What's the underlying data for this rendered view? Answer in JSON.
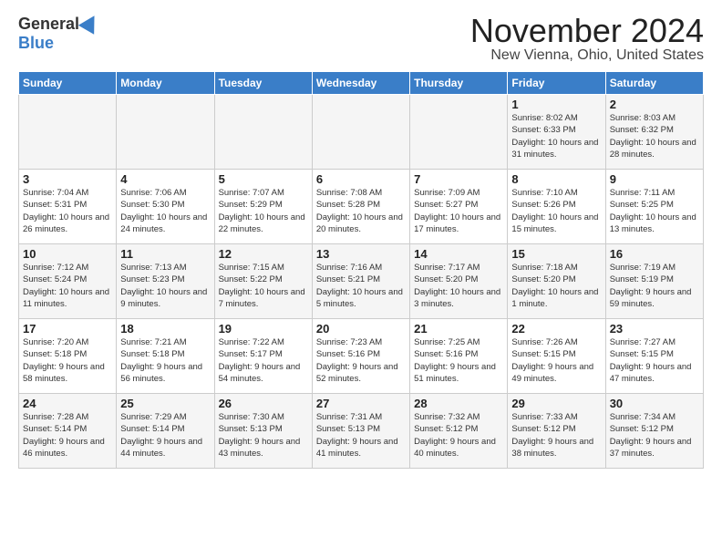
{
  "logo": {
    "general": "General",
    "blue": "Blue"
  },
  "title": "November 2024",
  "location": "New Vienna, Ohio, United States",
  "days_of_week": [
    "Sunday",
    "Monday",
    "Tuesday",
    "Wednesday",
    "Thursday",
    "Friday",
    "Saturday"
  ],
  "weeks": [
    [
      {
        "day": "",
        "info": ""
      },
      {
        "day": "",
        "info": ""
      },
      {
        "day": "",
        "info": ""
      },
      {
        "day": "",
        "info": ""
      },
      {
        "day": "",
        "info": ""
      },
      {
        "day": "1",
        "info": "Sunrise: 8:02 AM\nSunset: 6:33 PM\nDaylight: 10 hours and 31 minutes."
      },
      {
        "day": "2",
        "info": "Sunrise: 8:03 AM\nSunset: 6:32 PM\nDaylight: 10 hours and 28 minutes."
      }
    ],
    [
      {
        "day": "3",
        "info": "Sunrise: 7:04 AM\nSunset: 5:31 PM\nDaylight: 10 hours and 26 minutes."
      },
      {
        "day": "4",
        "info": "Sunrise: 7:06 AM\nSunset: 5:30 PM\nDaylight: 10 hours and 24 minutes."
      },
      {
        "day": "5",
        "info": "Sunrise: 7:07 AM\nSunset: 5:29 PM\nDaylight: 10 hours and 22 minutes."
      },
      {
        "day": "6",
        "info": "Sunrise: 7:08 AM\nSunset: 5:28 PM\nDaylight: 10 hours and 20 minutes."
      },
      {
        "day": "7",
        "info": "Sunrise: 7:09 AM\nSunset: 5:27 PM\nDaylight: 10 hours and 17 minutes."
      },
      {
        "day": "8",
        "info": "Sunrise: 7:10 AM\nSunset: 5:26 PM\nDaylight: 10 hours and 15 minutes."
      },
      {
        "day": "9",
        "info": "Sunrise: 7:11 AM\nSunset: 5:25 PM\nDaylight: 10 hours and 13 minutes."
      }
    ],
    [
      {
        "day": "10",
        "info": "Sunrise: 7:12 AM\nSunset: 5:24 PM\nDaylight: 10 hours and 11 minutes."
      },
      {
        "day": "11",
        "info": "Sunrise: 7:13 AM\nSunset: 5:23 PM\nDaylight: 10 hours and 9 minutes."
      },
      {
        "day": "12",
        "info": "Sunrise: 7:15 AM\nSunset: 5:22 PM\nDaylight: 10 hours and 7 minutes."
      },
      {
        "day": "13",
        "info": "Sunrise: 7:16 AM\nSunset: 5:21 PM\nDaylight: 10 hours and 5 minutes."
      },
      {
        "day": "14",
        "info": "Sunrise: 7:17 AM\nSunset: 5:20 PM\nDaylight: 10 hours and 3 minutes."
      },
      {
        "day": "15",
        "info": "Sunrise: 7:18 AM\nSunset: 5:20 PM\nDaylight: 10 hours and 1 minute."
      },
      {
        "day": "16",
        "info": "Sunrise: 7:19 AM\nSunset: 5:19 PM\nDaylight: 9 hours and 59 minutes."
      }
    ],
    [
      {
        "day": "17",
        "info": "Sunrise: 7:20 AM\nSunset: 5:18 PM\nDaylight: 9 hours and 58 minutes."
      },
      {
        "day": "18",
        "info": "Sunrise: 7:21 AM\nSunset: 5:18 PM\nDaylight: 9 hours and 56 minutes."
      },
      {
        "day": "19",
        "info": "Sunrise: 7:22 AM\nSunset: 5:17 PM\nDaylight: 9 hours and 54 minutes."
      },
      {
        "day": "20",
        "info": "Sunrise: 7:23 AM\nSunset: 5:16 PM\nDaylight: 9 hours and 52 minutes."
      },
      {
        "day": "21",
        "info": "Sunrise: 7:25 AM\nSunset: 5:16 PM\nDaylight: 9 hours and 51 minutes."
      },
      {
        "day": "22",
        "info": "Sunrise: 7:26 AM\nSunset: 5:15 PM\nDaylight: 9 hours and 49 minutes."
      },
      {
        "day": "23",
        "info": "Sunrise: 7:27 AM\nSunset: 5:15 PM\nDaylight: 9 hours and 47 minutes."
      }
    ],
    [
      {
        "day": "24",
        "info": "Sunrise: 7:28 AM\nSunset: 5:14 PM\nDaylight: 9 hours and 46 minutes."
      },
      {
        "day": "25",
        "info": "Sunrise: 7:29 AM\nSunset: 5:14 PM\nDaylight: 9 hours and 44 minutes."
      },
      {
        "day": "26",
        "info": "Sunrise: 7:30 AM\nSunset: 5:13 PM\nDaylight: 9 hours and 43 minutes."
      },
      {
        "day": "27",
        "info": "Sunrise: 7:31 AM\nSunset: 5:13 PM\nDaylight: 9 hours and 41 minutes."
      },
      {
        "day": "28",
        "info": "Sunrise: 7:32 AM\nSunset: 5:12 PM\nDaylight: 9 hours and 40 minutes."
      },
      {
        "day": "29",
        "info": "Sunrise: 7:33 AM\nSunset: 5:12 PM\nDaylight: 9 hours and 38 minutes."
      },
      {
        "day": "30",
        "info": "Sunrise: 7:34 AM\nSunset: 5:12 PM\nDaylight: 9 hours and 37 minutes."
      }
    ]
  ]
}
